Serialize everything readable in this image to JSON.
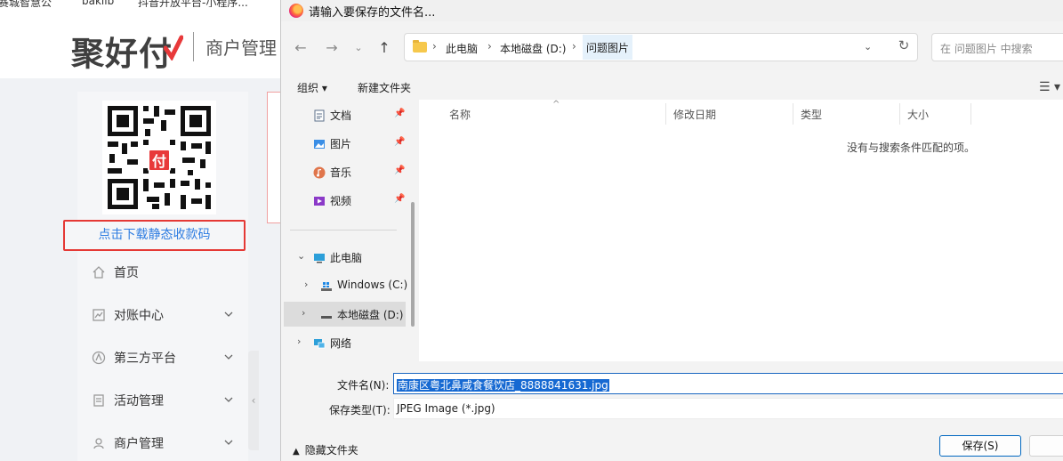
{
  "bookmarks": [
    "赛城智慧公",
    "bakilb",
    "抖音开放平台-小程序..."
  ],
  "site": {
    "logo": "聚好付",
    "header_title": "商户管理",
    "qr_badge": "付",
    "download_label": "点击下载静态收款码",
    "nav": [
      {
        "label": "首页",
        "icon": "home-icon",
        "has_chevron": false
      },
      {
        "label": "对账中心",
        "icon": "chart-icon",
        "has_chevron": true
      },
      {
        "label": "第三方平台",
        "icon": "platform-icon",
        "has_chevron": true
      },
      {
        "label": "活动管理",
        "icon": "activity-icon",
        "has_chevron": true
      },
      {
        "label": "商户管理",
        "icon": "merchant-icon",
        "has_chevron": true
      }
    ],
    "collapse_glyph": "‹"
  },
  "dialog": {
    "title": "请输入要保存的文件名...",
    "breadcrumb": [
      "此电脑",
      "本地磁盘 (D:)",
      "问题图片"
    ],
    "search_placeholder": "在 问题图片 中搜索",
    "toolbar": {
      "organize": "组织 ▾",
      "new_folder": "新建文件夹"
    },
    "nav_pane": [
      {
        "label": "文档",
        "icon": "document-icon",
        "pinned": true
      },
      {
        "label": "图片",
        "icon": "pictures-icon",
        "pinned": true
      },
      {
        "label": "音乐",
        "icon": "music-icon",
        "pinned": true
      },
      {
        "label": "视频",
        "icon": "video-icon",
        "pinned": true
      },
      {
        "label": "此电脑",
        "icon": "computer-icon",
        "expanded": true
      },
      {
        "label": "Windows (C:)",
        "icon": "windows-drive-icon"
      },
      {
        "label": "本地磁盘 (D:)",
        "icon": "drive-icon",
        "selected": true
      },
      {
        "label": "网络",
        "icon": "network-icon"
      }
    ],
    "columns": [
      "名称",
      "修改日期",
      "类型",
      "大小"
    ],
    "empty_message": "没有与搜索条件匹配的项。",
    "filename_label": "文件名(N):",
    "filename_value": "南康区粤北鼻咸食餐饮店_8888841631.jpg",
    "filetype_label": "保存类型(T):",
    "filetype_value": "JPEG Image (*.jpg)",
    "hide_folders": "隐藏文件夹",
    "save_label": "保存(S)"
  }
}
